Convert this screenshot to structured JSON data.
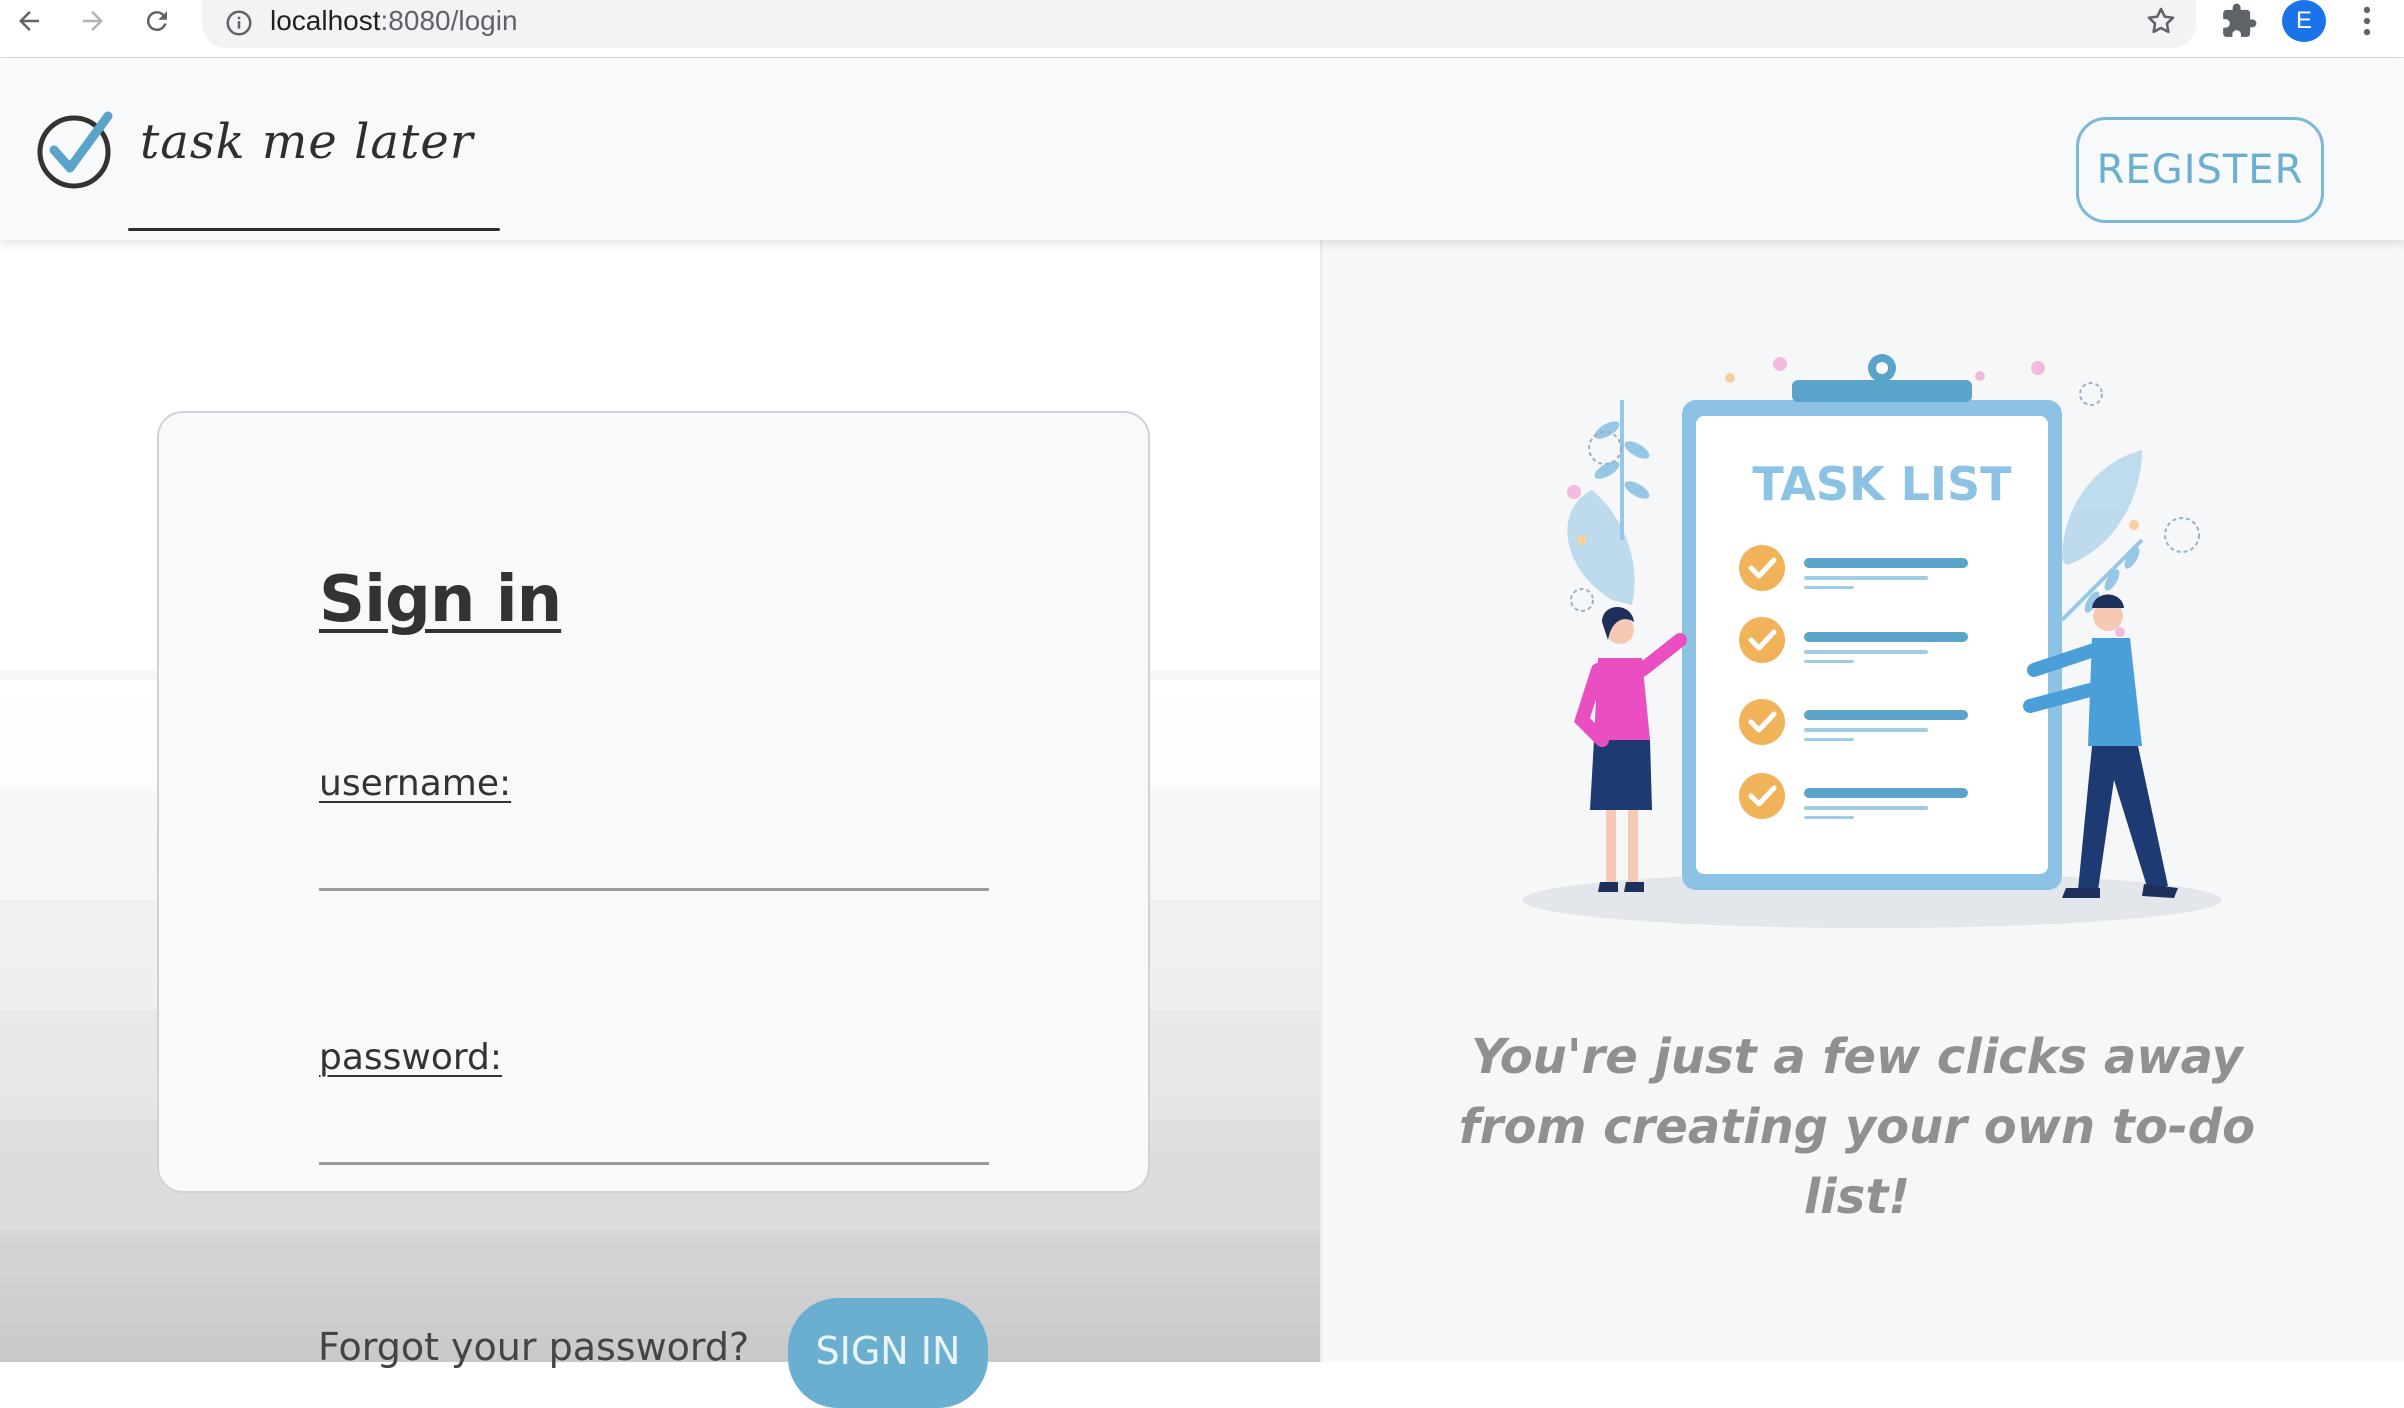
{
  "browser": {
    "url_host": "localhost",
    "url_path": ":8080/login",
    "profile_initial": "E"
  },
  "header": {
    "logo_text": "task me later",
    "register_label": "REGISTER"
  },
  "signin": {
    "title": "Sign in",
    "username_label": "username:",
    "username_value": "",
    "password_label": "password:",
    "password_value": "",
    "forgot_label": "Forgot your password?",
    "signin_label": "SIGN IN"
  },
  "promo": {
    "illustration_heading": "TASK LIST",
    "tagline": "You're just a few clicks away from creating your own to-do list!"
  },
  "colors": {
    "accent": "#6aaed0",
    "checkmark": "#f0b35a",
    "clipboard": "#8cc3e4",
    "text_dark": "#333333",
    "tagline": "#8f9092"
  }
}
